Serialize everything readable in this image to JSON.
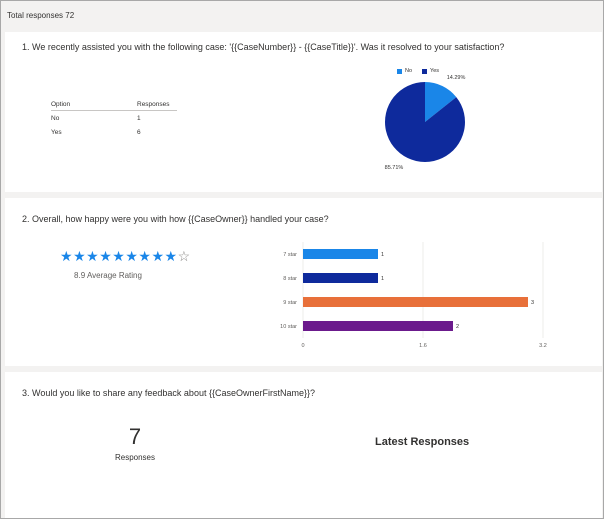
{
  "header": {
    "total_responses": "Total responses 72"
  },
  "q1": {
    "title": "1. We recently assisted you with the following case: '{{CaseNumber}} - {{CaseTitle}}'. Was it resolved to your satisfaction?",
    "table_headers": [
      "Option",
      "Responses"
    ],
    "rows": [
      {
        "option": "No",
        "responses": "1"
      },
      {
        "option": "Yes",
        "responses": "6"
      }
    ],
    "legend": [
      {
        "label": "No",
        "color": "#1a86e8"
      },
      {
        "label": "Yes",
        "color": "#0e2a9c"
      }
    ]
  },
  "q2": {
    "title": "2. Overall, how happy were you with how {{CaseOwner}} handled your case?",
    "rating": {
      "filled": 9,
      "total": 10,
      "label": "8.9 Average Rating"
    }
  },
  "q3": {
    "title": "3. Would you like to share any feedback about {{CaseOwnerFirstName}}?",
    "count": "7",
    "count_label": "Responses",
    "latest_heading": "Latest Responses"
  },
  "chart_data": [
    {
      "type": "pie",
      "categories": [
        "No",
        "Yes"
      ],
      "values": [
        14.29,
        85.71
      ],
      "colors": [
        "#1a86e8",
        "#0e2a9c"
      ],
      "labels": [
        "14.29%",
        "85.71%"
      ],
      "legend_position": "top"
    },
    {
      "type": "bar",
      "orientation": "horizontal",
      "categories": [
        "7 star",
        "8 star",
        "9 star",
        "10 star"
      ],
      "values": [
        1,
        1,
        3,
        2
      ],
      "colors": [
        "#1a86e8",
        "#0e2a9c",
        "#e8703a",
        "#6b1a8c"
      ],
      "xlim": [
        0,
        3.2
      ],
      "xticks": [
        "0",
        "1.6",
        "3.2"
      ],
      "grid": true
    }
  ]
}
